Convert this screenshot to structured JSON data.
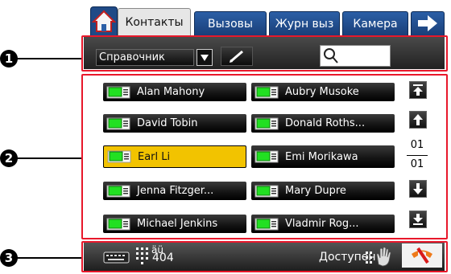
{
  "callouts": [
    "1",
    "2",
    "3"
  ],
  "tabs": [
    {
      "label": "Контакты",
      "active": true
    },
    {
      "label": "Вызовы",
      "active": false
    },
    {
      "label": "Журн выз",
      "active": false
    },
    {
      "label": "Камера",
      "active": false
    }
  ],
  "toolbar": {
    "directory_label": "Справочник",
    "search_value": ""
  },
  "contacts": [
    "Alan Mahony",
    "Aubry Musoke",
    "David Tobin",
    "Donald Roths...",
    "Earl Li",
    "Emi Morikawa",
    "Jenna Fitzger...",
    "Mary Dupre",
    "Michael Jenkins",
    "Vladmir Rog..."
  ],
  "selected_contact": "Earl Li",
  "pagination": {
    "current": "01",
    "total": "01"
  },
  "statusbar": {
    "dial_mode": "äü",
    "extension": "404",
    "status": "Доступен"
  },
  "colors": {
    "frame": "#e8182b",
    "tab_blue": "#1f4a86",
    "selected": "#f2c300",
    "contact_icon": "#22e022"
  },
  "icons": [
    "home-icon",
    "forward-arrow-icon",
    "dropdown-arrow-icon",
    "pencil-icon",
    "search-icon",
    "contact-card-icon",
    "scroll-top-icon",
    "scroll-up-icon",
    "scroll-down-icon",
    "scroll-bottom-icon",
    "keyboard-icon",
    "dialpad-icon",
    "dnd-hand-icon",
    "hangup-icon"
  ]
}
